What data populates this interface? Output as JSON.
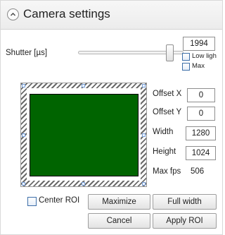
{
  "header": {
    "title": "Camera settings",
    "collapse_icon": "chevron-up-icon"
  },
  "shutter": {
    "label": "Shutter [µs]",
    "value": "1994",
    "slider_level": 0.9,
    "low_light_label": "Low ligh",
    "max_label": "Max"
  },
  "roi": {
    "fill_color": "#006400",
    "fields": {
      "offset_x": {
        "label": "Offset X",
        "value": "0"
      },
      "offset_y": {
        "label": "Offset Y",
        "value": "0"
      },
      "width": {
        "label": "Width",
        "value": "1280"
      },
      "height": {
        "label": "Height",
        "value": "1024"
      }
    },
    "max_fps": {
      "label": "Max fps",
      "value": "506"
    }
  },
  "buttons": {
    "center_roi_label": "Center ROI",
    "maximize": "Maximize",
    "full_width": "Full width",
    "cancel": "Cancel",
    "apply_roi": "Apply ROI"
  }
}
